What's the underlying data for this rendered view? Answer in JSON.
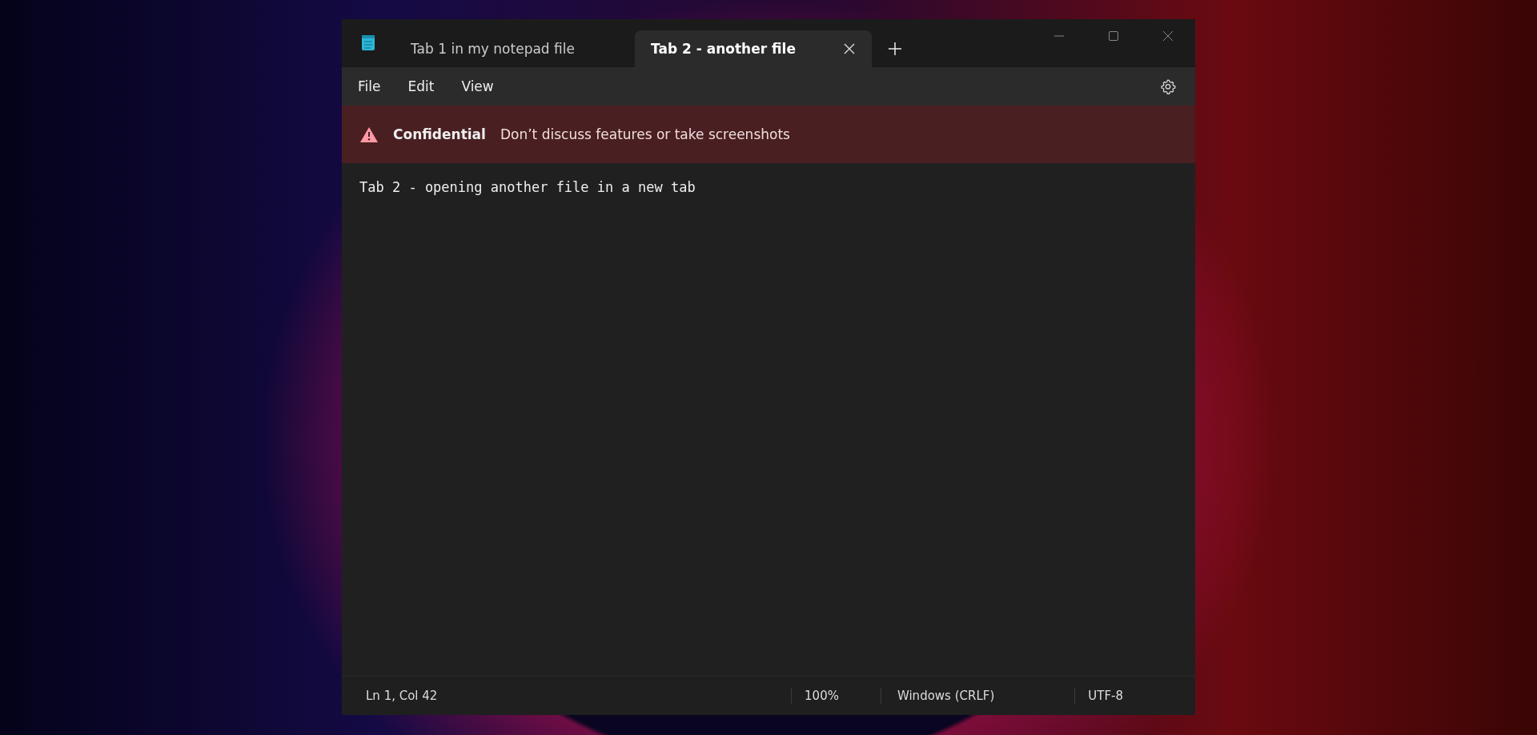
{
  "tabs": [
    {
      "label": "Tab 1 in my notepad file",
      "selected": false
    },
    {
      "label": "Tab 2 - another file",
      "selected": true
    }
  ],
  "menu": [
    "File",
    "Edit",
    "View"
  ],
  "banner": {
    "title": "Confidential",
    "message": "Don’t discuss features or take screenshots"
  },
  "editor": {
    "text": "Tab 2 - opening another file in a new tab"
  },
  "status_bar": {
    "position": "Ln 1, Col 42",
    "zoom": "100%",
    "line_ending": "Windows (CRLF)",
    "encoding": "UTF-8"
  }
}
